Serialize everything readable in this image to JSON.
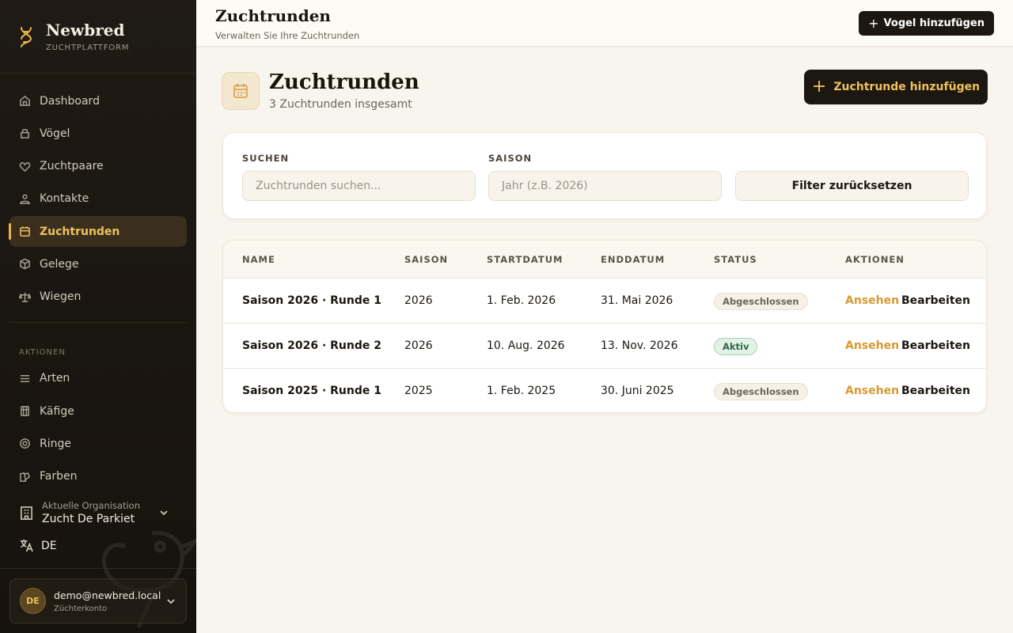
{
  "brand": {
    "name": "Newbred",
    "subtitle": "ZUCHTPLATTFORM"
  },
  "sidebar": {
    "nav": [
      {
        "label": "Dashboard",
        "icon": "home-icon"
      },
      {
        "label": "Vögel",
        "icon": "bird-icon"
      },
      {
        "label": "Zuchtpaare",
        "icon": "heart-icon"
      },
      {
        "label": "Kontakte",
        "icon": "contacts-icon"
      },
      {
        "label": "Zuchtrunden",
        "icon": "calendar-icon",
        "active": true
      },
      {
        "label": "Gelege",
        "icon": "box-icon"
      },
      {
        "label": "Wiegen",
        "icon": "scale-icon"
      }
    ],
    "actions_label": "AKTIONEN",
    "actions": [
      {
        "label": "Arten",
        "icon": "list-icon"
      },
      {
        "label": "Käfige",
        "icon": "cage-icon"
      },
      {
        "label": "Ringe",
        "icon": "ring-icon"
      },
      {
        "label": "Farben",
        "icon": "palette-icon"
      }
    ],
    "org": {
      "label": "Aktuelle Organisation",
      "value": "Zucht De Parkiet"
    },
    "language": "DE",
    "user": {
      "initials": "DE",
      "email": "demo@newbred.local",
      "role": "Züchterkonto"
    }
  },
  "topbar": {
    "title": "Zuchtrunden",
    "subtitle": "Verwalten Sie Ihre Zuchtrunden",
    "add_bird_label": "Vogel hinzufügen"
  },
  "page": {
    "title": "Zuchtrunden",
    "count_text": "3 Zuchtrunden insgesamt",
    "add_round_label": "Zuchtrunde hinzufügen"
  },
  "filters": {
    "search_label": "SUCHEN",
    "search_placeholder": "Zuchtrunden suchen...",
    "season_label": "SAISON",
    "season_placeholder": "Jahr (z.B. 2026)",
    "reset_label": "Filter zurücksetzen"
  },
  "table": {
    "headers": [
      "NAME",
      "SAISON",
      "STARTDATUM",
      "ENDDATUM",
      "STATUS",
      "AKTIONEN"
    ],
    "view_label": "Ansehen",
    "edit_label": "Bearbeiten",
    "rows": [
      {
        "name": "Saison 2026 · Runde 1",
        "season": "2026",
        "start": "1. Feb. 2026",
        "end": "31. Mai 2026",
        "status": "Abgeschlossen"
      },
      {
        "name": "Saison 2026 · Runde 2",
        "season": "2026",
        "start": "10. Aug. 2026",
        "end": "13. Nov. 2026",
        "status": "Aktiv"
      },
      {
        "name": "Saison 2025 · Runde 1",
        "season": "2025",
        "start": "1. Feb. 2025",
        "end": "30. Juni 2025",
        "status": "Abgeschlossen"
      }
    ]
  },
  "colors": {
    "accent": "#f0c15c",
    "sidebar_bg": "#1f1a14",
    "page_bg": "#f8f5ee",
    "primary_button": "#1c1710",
    "active_badge": "#e3f2e8"
  }
}
